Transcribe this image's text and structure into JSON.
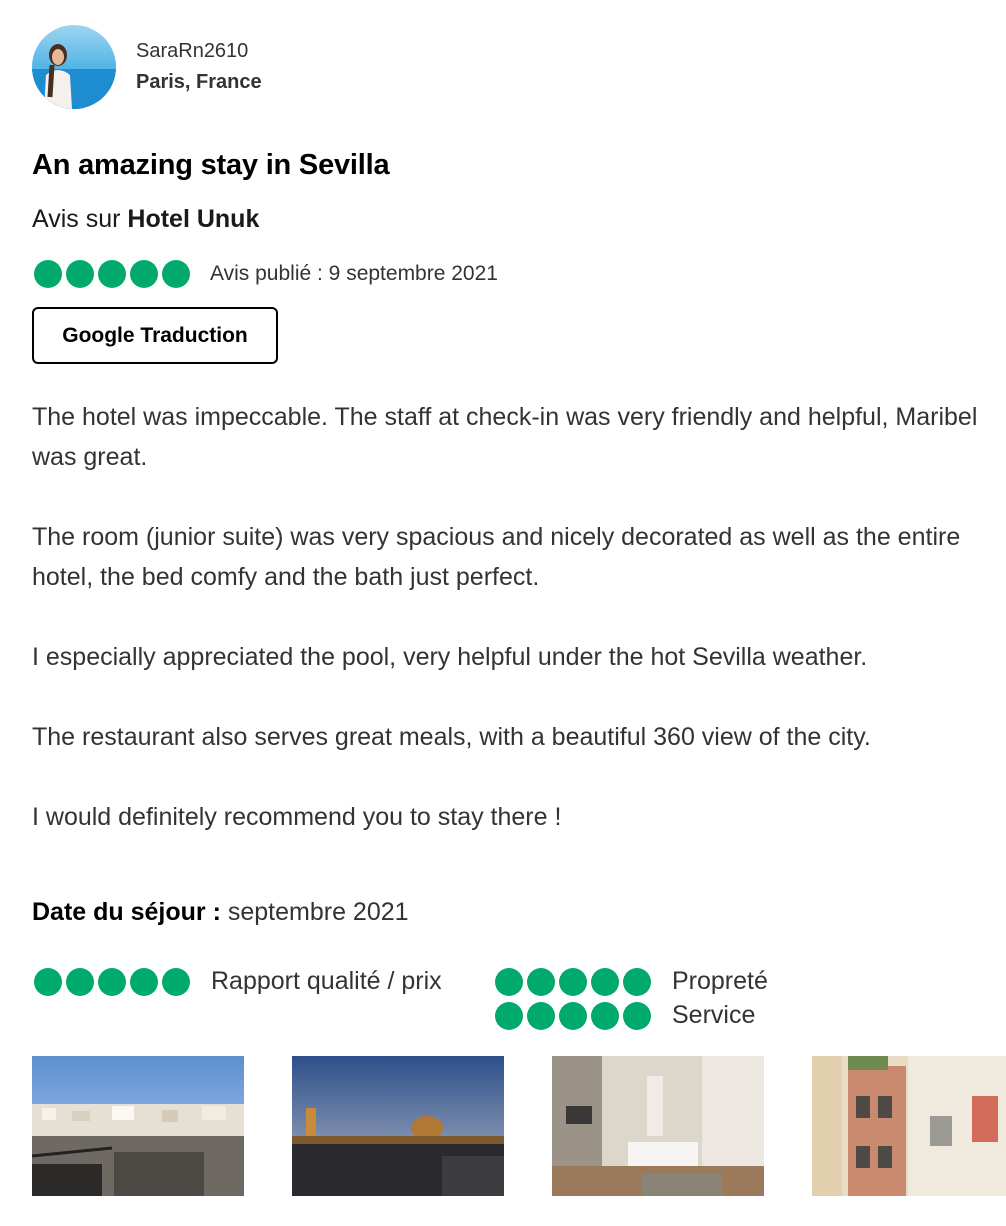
{
  "reviewer": {
    "username": "SaraRn2610",
    "location": "Paris, France",
    "avatar_icon": "profile-photo"
  },
  "review": {
    "title": "An amazing stay in Sevilla",
    "about_prefix": "Avis sur",
    "hotel_name": "Hotel Unuk",
    "rating": 5,
    "rating_max": 5,
    "published": "Avis publié : 9 septembre 2021",
    "translate_button": "Google Traduction",
    "paragraphs": [
      "The hotel was impeccable. The staff at check-in was very friendly and helpful, Maribel was great.",
      "The room (junior suite) was very spacious and nicely decorated as well as the entire hotel, the bed comfy and the bath just perfect.",
      "I especially appreciated the pool, very helpful under the hot Sevilla weather.",
      "The restaurant also serves great meals, with a beautiful 360 view of the city.",
      "I would definitely recommend you to stay there !"
    ],
    "stay_label": "Date du séjour :",
    "stay_value": "septembre 2021",
    "sub_ratings": [
      {
        "label": "Rapport qualité / prix",
        "rating": 5
      },
      {
        "label": "Propreté",
        "rating": 5
      },
      {
        "label": "Service",
        "rating": 5
      }
    ]
  },
  "photos": [
    {
      "subject": "rooftop-city-view-photo"
    },
    {
      "subject": "city-skyline-dusk-photo"
    },
    {
      "subject": "hotel-room-photo"
    },
    {
      "subject": "street-balconies-photo"
    }
  ],
  "colors": {
    "rating_bubble": "#00aa6c",
    "text": "#333333",
    "heading": "#000000"
  }
}
